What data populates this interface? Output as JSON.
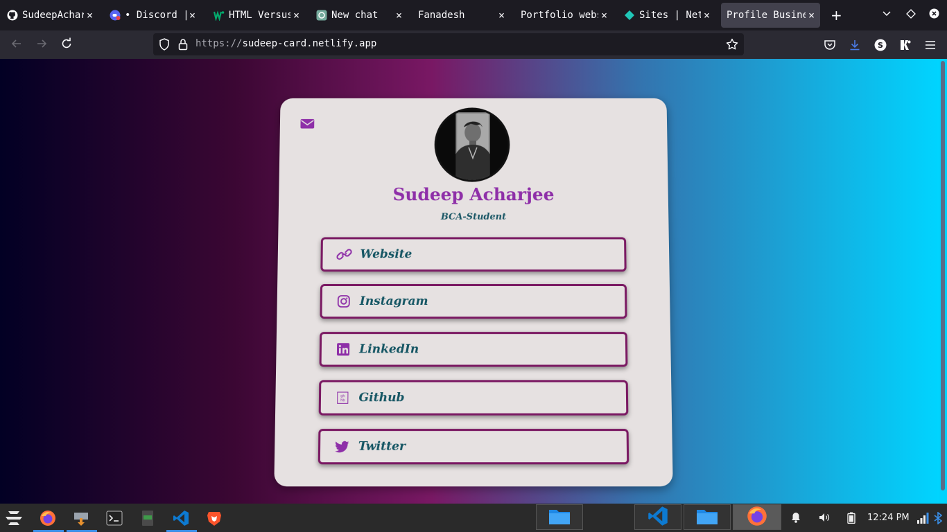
{
  "browser": {
    "tabs": [
      {
        "title": "SudeepAcharjee",
        "icon": "github-icon"
      },
      {
        "title": "• Discord | Ch",
        "icon": "discord-icon"
      },
      {
        "title": "HTML Versus",
        "icon": "w3-icon"
      },
      {
        "title": "New chat",
        "icon": "chatgpt-icon"
      },
      {
        "title": "Fanadesh",
        "icon": "none"
      },
      {
        "title": "Portfolio website",
        "icon": "none"
      },
      {
        "title": "Sites | Netlify",
        "icon": "netlify-icon"
      },
      {
        "title": "Profile Business",
        "icon": "none",
        "active": true
      }
    ],
    "url": {
      "protocol": "https://",
      "host": "sudeep-card.netlify.app"
    },
    "profile_initial": "S"
  },
  "card": {
    "name": "Sudeep Acharjee",
    "role": "BCA-Student",
    "links": [
      {
        "label": "Website",
        "icon": "link-icon"
      },
      {
        "label": "Instagram",
        "icon": "instagram-icon"
      },
      {
        "label": "LinkedIn",
        "icon": "linkedin-icon"
      },
      {
        "label": "Github",
        "icon": "github-icon"
      },
      {
        "label": "Twitter",
        "icon": "twitter-icon"
      }
    ],
    "colors": {
      "accent": "#8e2fa8",
      "link_text": "#145563",
      "link_border": "#7b1a63",
      "card_bg": "#e6e1e1"
    }
  },
  "taskbar": {
    "apps": [
      "zorin-menu-icon",
      "firefox-icon",
      "installer-icon",
      "terminal-icon",
      "notes-icon",
      "vscode-icon",
      "brave-icon"
    ],
    "windows": [
      "files-icon",
      "vscode-icon",
      "files-icon",
      "firefox-icon"
    ],
    "clock": "12:24 PM"
  }
}
